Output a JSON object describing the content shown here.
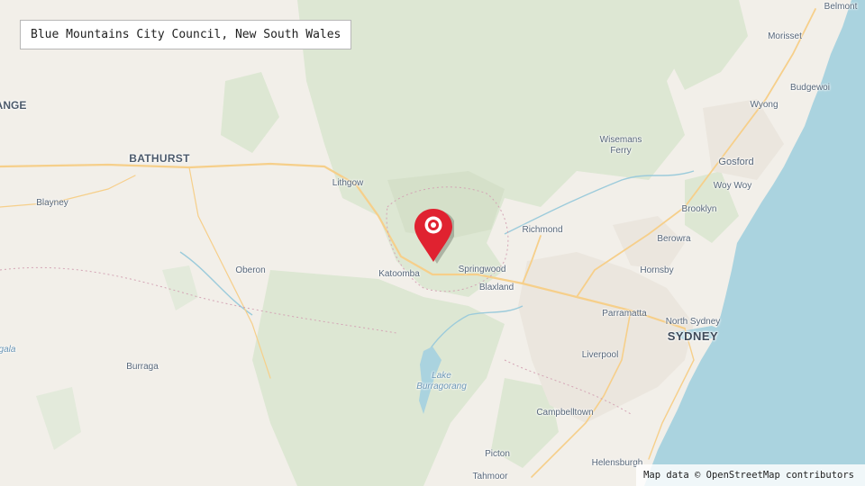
{
  "title": "Blue Mountains City Council, New South Wales",
  "attribution": "Map data © OpenStreetMap contributors",
  "marker_icon": "map-pin-icon",
  "colors": {
    "land": "#f2efe9",
    "forest": "#dfe8d6",
    "water": "#aad3df",
    "urban": "#ece8e1",
    "road": "#fcd99a",
    "marker": "#e02230"
  },
  "places": {
    "bathurst": "BATHURST",
    "range_fragment": "ANGE",
    "sydney": "SYDNEY",
    "blayney": "Blayney",
    "oberon": "Oberon",
    "burraga": "Burraga",
    "gala_fragment": "gala",
    "lithgow": "Lithgow",
    "katoomba": "Katoomba",
    "springwood": "Springwood",
    "blaxland": "Blaxland",
    "richmond": "Richmond",
    "wisemans_ferry": "Wisemans Ferry",
    "belmont": "Belmont",
    "morisset": "Morisset",
    "budgewoi": "Budgewoi",
    "wyong": "Wyong",
    "gosford": "Gosford",
    "woy_woy": "Woy Woy",
    "brooklyn": "Brooklyn",
    "berowra": "Berowra",
    "hornsby": "Hornsby",
    "parramatta": "Parramatta",
    "north_sydney": "North Sydney",
    "liverpool": "Liverpool",
    "campbelltown": "Campbelltown",
    "picton": "Picton",
    "tahmoor": "Tahmoor",
    "helensburgh": "Helensburgh",
    "lake_burragorang": "Lake Burragorang"
  }
}
